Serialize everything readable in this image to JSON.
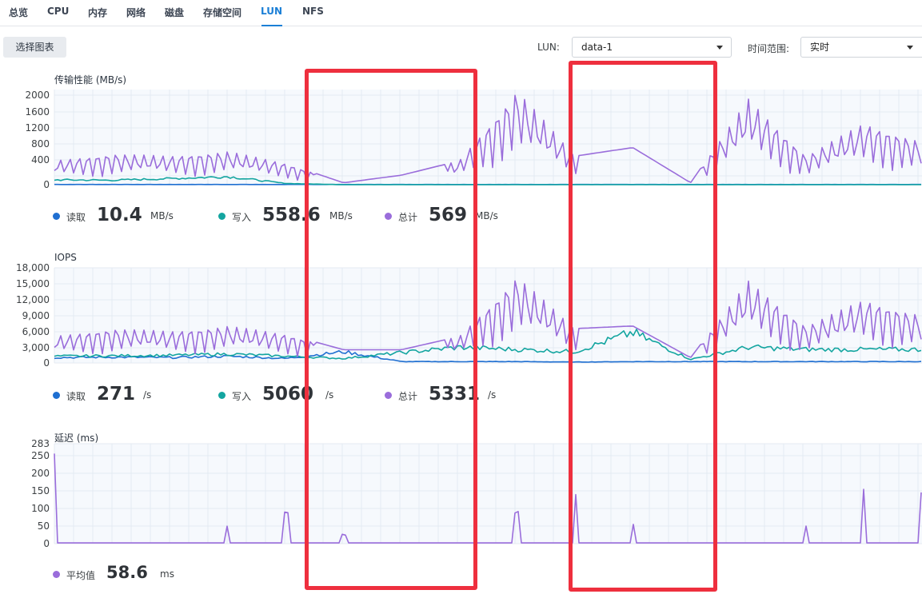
{
  "tabs": [
    "总览",
    "CPU",
    "内存",
    "网络",
    "磁盘",
    "存储空间",
    "LUN",
    "NFS"
  ],
  "active_tab": "LUN",
  "toolbar": {
    "select_chart_label": "选择图表",
    "lun_label": "LUN:",
    "lun_value": "data-1",
    "time_range_label": "时间范围:",
    "time_range_value": "实时"
  },
  "colors": {
    "read": "#1f6fd1",
    "write": "#13a5a0",
    "total": "#9a6ddb",
    "accent": "#1b7fd6",
    "highlight": "#ee2f3e"
  },
  "charts": [
    {
      "title": "传输性能 (MB/s)",
      "y_ticks": [
        "2000",
        "1600",
        "1200",
        "800",
        "400",
        "0"
      ],
      "legend": [
        {
          "name": "读取",
          "value": "10.4",
          "unit": "MB/s"
        },
        {
          "name": "写入",
          "value": "558.6",
          "unit": "MB/s"
        },
        {
          "name": "总计",
          "value": "569",
          "unit": "MB/s"
        }
      ]
    },
    {
      "title": "IOPS",
      "y_ticks": [
        "18,000",
        "15,000",
        "12,000",
        "9,000",
        "6,000",
        "3,000",
        "0"
      ],
      "legend": [
        {
          "name": "读取",
          "value": "271",
          "unit": "/s"
        },
        {
          "name": "写入",
          "value": "5060",
          "unit": "/s"
        },
        {
          "name": "总计",
          "value": "5331",
          "unit": "/s"
        }
      ]
    },
    {
      "title": "延迟 (ms)",
      "y_ticks": [
        "283",
        "250",
        "200",
        "150",
        "100",
        "50",
        "0"
      ],
      "legend": [
        {
          "name": "平均值",
          "value": "58.6",
          "unit": "ms"
        }
      ]
    }
  ],
  "chart_data": [
    {
      "type": "line",
      "title": "传输性能 (MB/s)",
      "ylim": [
        0,
        2000
      ],
      "grid": true,
      "series": [
        {
          "name": "读取",
          "values": [
            5,
            5,
            5,
            5,
            5,
            5,
            5,
            5,
            5,
            5,
            5,
            5,
            5,
            5,
            5,
            5
          ]
        },
        {
          "name": "写入",
          "values": [
            120,
            110,
            150,
            200,
            30,
            0,
            0,
            0,
            0,
            0,
            0,
            0,
            0,
            0,
            0,
            0
          ]
        },
        {
          "name": "总计",
          "values": [
            500,
            650,
            600,
            700,
            450,
            40,
            200,
            500,
            2000,
            600,
            780,
            40,
            1800,
            600,
            1300,
            900
          ]
        }
      ]
    },
    {
      "type": "line",
      "title": "IOPS",
      "ylim": [
        0,
        18000
      ],
      "grid": true,
      "series": [
        {
          "name": "读取",
          "values": [
            1200,
            1300,
            1200,
            1500,
            1000,
            2500,
            300,
            300,
            300,
            200,
            300,
            300,
            300,
            300,
            300,
            300
          ]
        },
        {
          "name": "写入",
          "values": [
            1500,
            1600,
            1700,
            2000,
            1500,
            1000,
            2300,
            3500,
            3000,
            2500,
            6800,
            800,
            3500,
            3000,
            3000,
            3000
          ]
        },
        {
          "name": "总计",
          "values": [
            5000,
            6500,
            6000,
            7000,
            5500,
            2500,
            2500,
            5000,
            16500,
            6500,
            7000,
            1000,
            15500,
            7000,
            12000,
            9000
          ]
        }
      ]
    },
    {
      "type": "line",
      "title": "延迟 (ms)",
      "ylim": [
        0,
        283
      ],
      "grid": true,
      "series": [
        {
          "name": "平均值",
          "values": [
            255,
            2,
            3,
            50,
            90,
            25,
            1,
            2,
            90,
            140,
            55,
            2,
            1,
            50,
            155,
            145
          ]
        }
      ]
    }
  ]
}
